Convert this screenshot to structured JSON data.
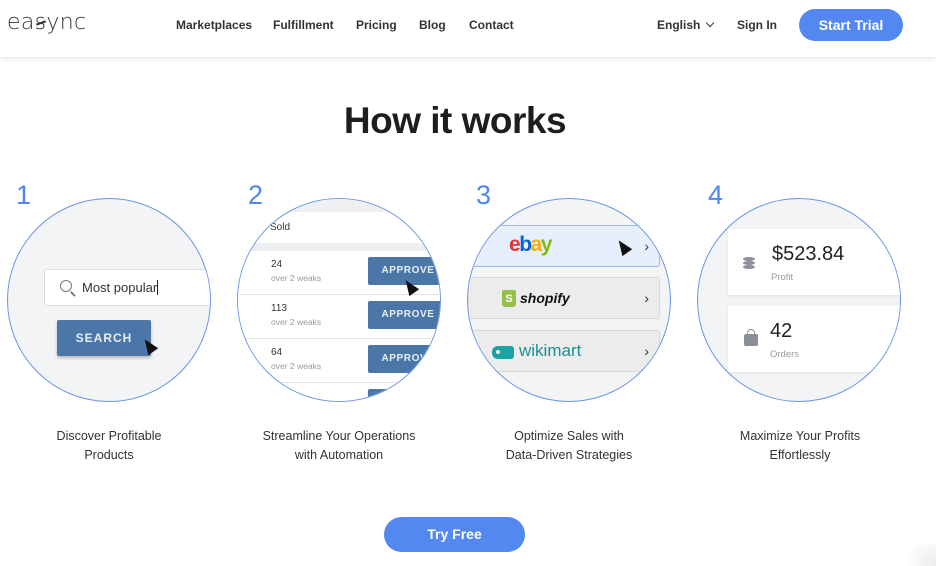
{
  "header": {
    "logo": {
      "pre": "ea",
      "s": "s",
      "post": "ync"
    },
    "nav": [
      {
        "label": "Marketplaces"
      },
      {
        "label": "Fulfillment"
      },
      {
        "label": "Pricing"
      },
      {
        "label": "Blog"
      },
      {
        "label": "Contact"
      }
    ],
    "language": "English",
    "sign_in": "Sign In",
    "start_trial": "Start Trial"
  },
  "section": {
    "title": "How it works"
  },
  "steps": [
    {
      "number": "1",
      "caption_line1": "Discover Profitable",
      "caption_line2": "Products",
      "search_value": "Most popular",
      "search_button": "SEARCH"
    },
    {
      "number": "2",
      "caption_line1": "Streamline Your Operations",
      "caption_line2": "with Automation",
      "column_header": "Sold",
      "rows": [
        {
          "value": "24",
          "sub": "over 2 weaks",
          "button": "APPROVE"
        },
        {
          "value": "113",
          "sub": "over 2 weaks",
          "button": "APPROVE"
        },
        {
          "value": "64",
          "sub": "over 2 weaks",
          "button": "APPROVE"
        }
      ]
    },
    {
      "number": "3",
      "caption_line1": "Optimize Sales with",
      "caption_line2": "Data-Driven Strategies",
      "marketplaces": [
        {
          "name": "ebay",
          "letters": [
            "e",
            "b",
            "a",
            "y"
          ]
        },
        {
          "name": "shopify",
          "icon_letter": "S"
        },
        {
          "name": "wikimart"
        }
      ],
      "arrow": "›"
    },
    {
      "number": "4",
      "caption_line1": "Maximize Your Profits",
      "caption_line2": "Effortlessly",
      "profit_value": "$523.84",
      "profit_label": "Profit",
      "orders_value": "42",
      "orders_label": "Orders"
    }
  ],
  "cta": {
    "try_free": "Try Free"
  },
  "colors": {
    "accent": "#5288f0",
    "step_number": "#4f86ec",
    "button_dark": "#4a76a8"
  }
}
